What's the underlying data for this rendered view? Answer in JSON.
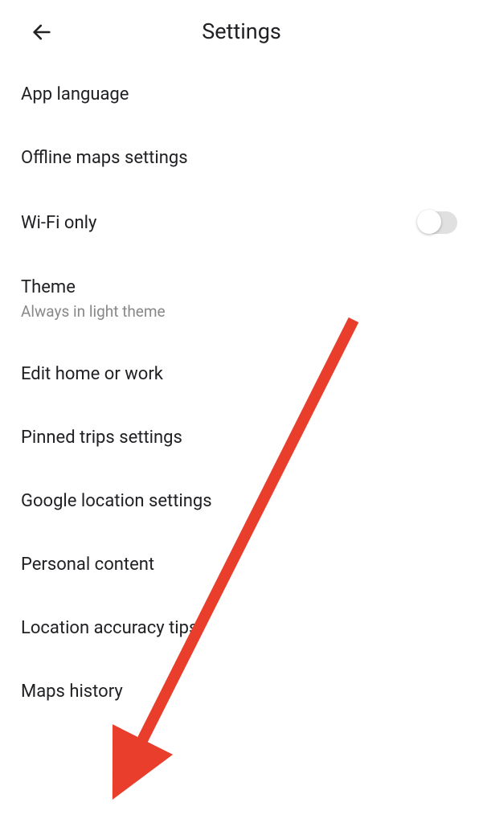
{
  "header": {
    "title": "Settings"
  },
  "settings": {
    "app_language": "App language",
    "offline_maps": "Offline maps settings",
    "wifi_only": "Wi-Fi only",
    "theme_label": "Theme",
    "theme_sublabel": "Always in light theme",
    "edit_home_work": "Edit home or work",
    "pinned_trips": "Pinned trips settings",
    "google_location": "Google location settings",
    "personal_content": "Personal content",
    "location_accuracy": "Location accuracy tips",
    "maps_history": "Maps history"
  },
  "annotation": {
    "arrow_color": "#e93e2b"
  }
}
